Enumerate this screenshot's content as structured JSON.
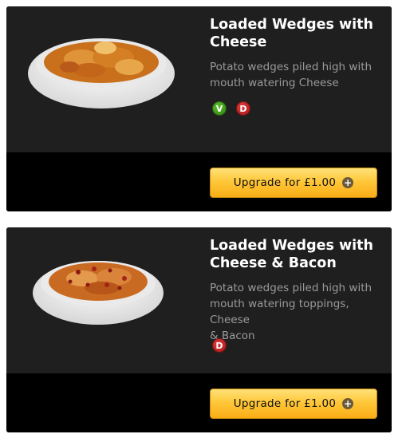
{
  "items": [
    {
      "title_line1": "Loaded Wedges with",
      "title_line2": "Cheese",
      "desc_lines": [
        "Potato wedges piled high with",
        "mouth watering Cheese"
      ],
      "badges": [
        {
          "letter": "V",
          "icon": "vegetarian-icon"
        },
        {
          "letter": "D",
          "icon": "dairy-icon"
        }
      ],
      "button_label": "Upgrade for £1.00"
    },
    {
      "title_line1": "Loaded Wedges with",
      "title_line2": "Cheese & Bacon",
      "desc_lines": [
        "Potato wedges piled high with",
        "mouth watering toppings, Cheese",
        "& Bacon"
      ],
      "badges": [
        {
          "letter": "D",
          "icon": "dairy-icon"
        }
      ],
      "button_label": "Upgrade for £1.00"
    }
  ],
  "colors": {
    "card": "#1f1f1f",
    "card_footer": "#000000",
    "button": "#ffc73a",
    "veg_badge": "#3f9a1c",
    "dairy_badge": "#c41f1f"
  }
}
